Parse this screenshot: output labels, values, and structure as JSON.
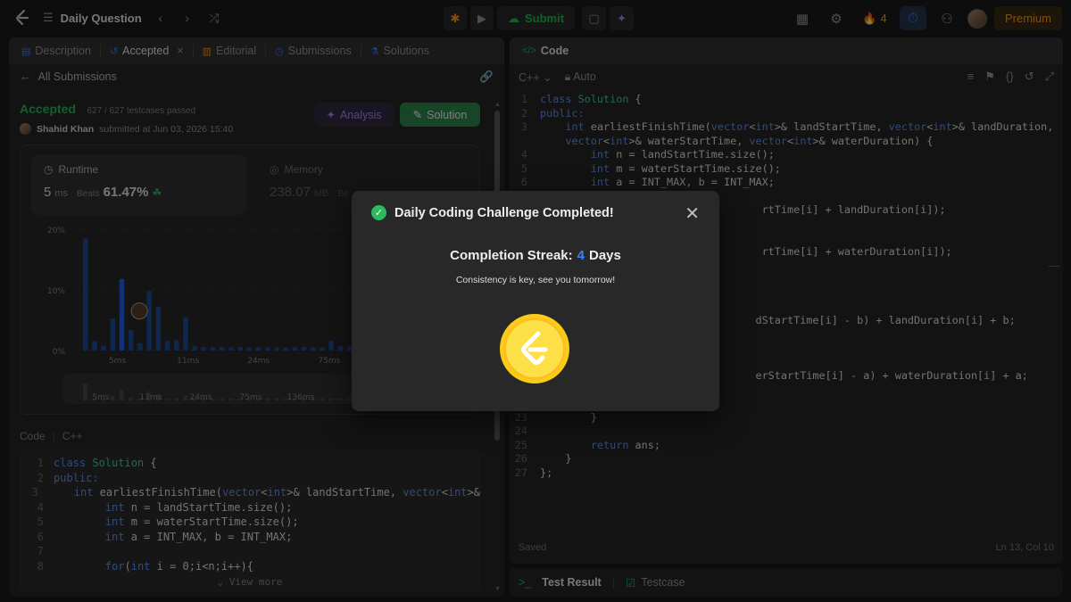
{
  "topbar": {
    "title": "Daily Question",
    "submit_label": "Submit",
    "streak_count": "4",
    "premium_label": "Premium"
  },
  "left": {
    "tabs": [
      "Description",
      "Accepted",
      "Editorial",
      "Submissions",
      "Solutions"
    ],
    "back_label": "All Submissions",
    "status": "Accepted",
    "testcases": "627 / 627 testcases passed",
    "author": "Shahid Khan",
    "submitted": "submitted at Jun 03, 2026 15:40",
    "analysis_label": "Analysis",
    "solution_label": "Solution",
    "runtime": {
      "label": "Runtime",
      "value": "5",
      "unit": "ms",
      "beats_label": "Beats",
      "beats_pct": "61.47%"
    },
    "memory": {
      "label": "Memory",
      "value": "238.07",
      "unit": "MB",
      "beats_label": "Be"
    },
    "code_lang": "Code",
    "code_lang2": "C++",
    "view_more": "View more",
    "code_lines": [
      {
        "n": "1",
        "t": "class Solution {"
      },
      {
        "n": "2",
        "t": "public:"
      },
      {
        "n": "3",
        "t": "    int earliestFinishTime(vector<int>& landStartTime, vector<int>&"
      },
      {
        "n": "4",
        "t": "        int n = landStartTime.size();"
      },
      {
        "n": "5",
        "t": "        int m = waterStartTime.size();"
      },
      {
        "n": "6",
        "t": "        int a = INT_MAX, b = INT_MAX;"
      },
      {
        "n": "7",
        "t": ""
      },
      {
        "n": "8",
        "t": "        for(int i = 0;i<n;i++){"
      }
    ]
  },
  "chart_data": {
    "type": "bar",
    "y_ticks": [
      "20%",
      "10%",
      "0%"
    ],
    "x_ticks": [
      "5ms",
      "11ms",
      "24ms",
      "75ms",
      "136ms"
    ],
    "mini_x_ticks": [
      "5ms",
      "11ms",
      "24ms",
      "75ms",
      "136ms"
    ],
    "ylim": [
      0,
      20
    ],
    "values": [
      18.5,
      1.6,
      0.8,
      5.3,
      11.8,
      3.4,
      1.2,
      9.8,
      7.2,
      1.6,
      1.7,
      5.5,
      0.7,
      0.6,
      0.6,
      0.6,
      0.5,
      0.6,
      0.5,
      0.6,
      0.5,
      0.5,
      0.5,
      0.5,
      0.6,
      0.5,
      0.5,
      1.6,
      0.7,
      0.6
    ],
    "highlight_index": 4,
    "grid": true
  },
  "right": {
    "tab": "Code",
    "lang": "C++",
    "mode": "Auto",
    "saved": "Saved",
    "cursor": "Ln 13, Col 10",
    "bottom_tab1": "Test Result",
    "bottom_tab2": "Testcase",
    "lines": [
      {
        "n": "1",
        "t": "class Solution {"
      },
      {
        "n": "2",
        "t": "public:"
      },
      {
        "n": "3",
        "t": "    int earliestFinishTime(vector<int>& landStartTime, vector<int>& landDuration,"
      },
      {
        "n": "",
        "t": "    vector<int>& waterStartTime, vector<int>& waterDuration) {"
      },
      {
        "n": "4",
        "t": "        int n = landStartTime.size();"
      },
      {
        "n": "5",
        "t": "        int m = waterStartTime.size();"
      },
      {
        "n": "6",
        "t": "        int a = INT_MAX, b = INT_MAX;"
      },
      {
        "n": "7",
        "t": ""
      },
      {
        "n": "8",
        "t": "                                   rtTime[i] + landDuration[i]);"
      },
      {
        "n": "9",
        "t": ""
      },
      {
        "n": "10",
        "t": ""
      },
      {
        "n": "11",
        "t": "                                   rtTime[i] + waterDuration[i]);"
      },
      {
        "n": "12",
        "t": ""
      },
      {
        "n": "13",
        "t": ""
      },
      {
        "n": "14",
        "t": ""
      },
      {
        "n": "15",
        "t": ""
      },
      {
        "n": "16",
        "t": "                                  dStartTime[i] - b) + landDuration[i] + b;"
      },
      {
        "n": "17",
        "t": ""
      },
      {
        "n": "18",
        "t": ""
      },
      {
        "n": "19",
        "t": ""
      },
      {
        "n": "20",
        "t": "                                  erStartTime[i] - a) + waterDuration[i] + a;"
      },
      {
        "n": "21",
        "t": ""
      },
      {
        "n": "22",
        "t": ""
      },
      {
        "n": "23",
        "t": "        }"
      },
      {
        "n": "24",
        "t": ""
      },
      {
        "n": "25",
        "t": "        return ans;"
      },
      {
        "n": "26",
        "t": "    }"
      },
      {
        "n": "27",
        "t": "};"
      }
    ]
  },
  "modal": {
    "title": "Daily Coding Challenge Completed!",
    "streak_label": "Completion Streak:",
    "streak_value": "4",
    "streak_unit": "Days",
    "message": "Consistency is key, see you tomorrow!"
  }
}
